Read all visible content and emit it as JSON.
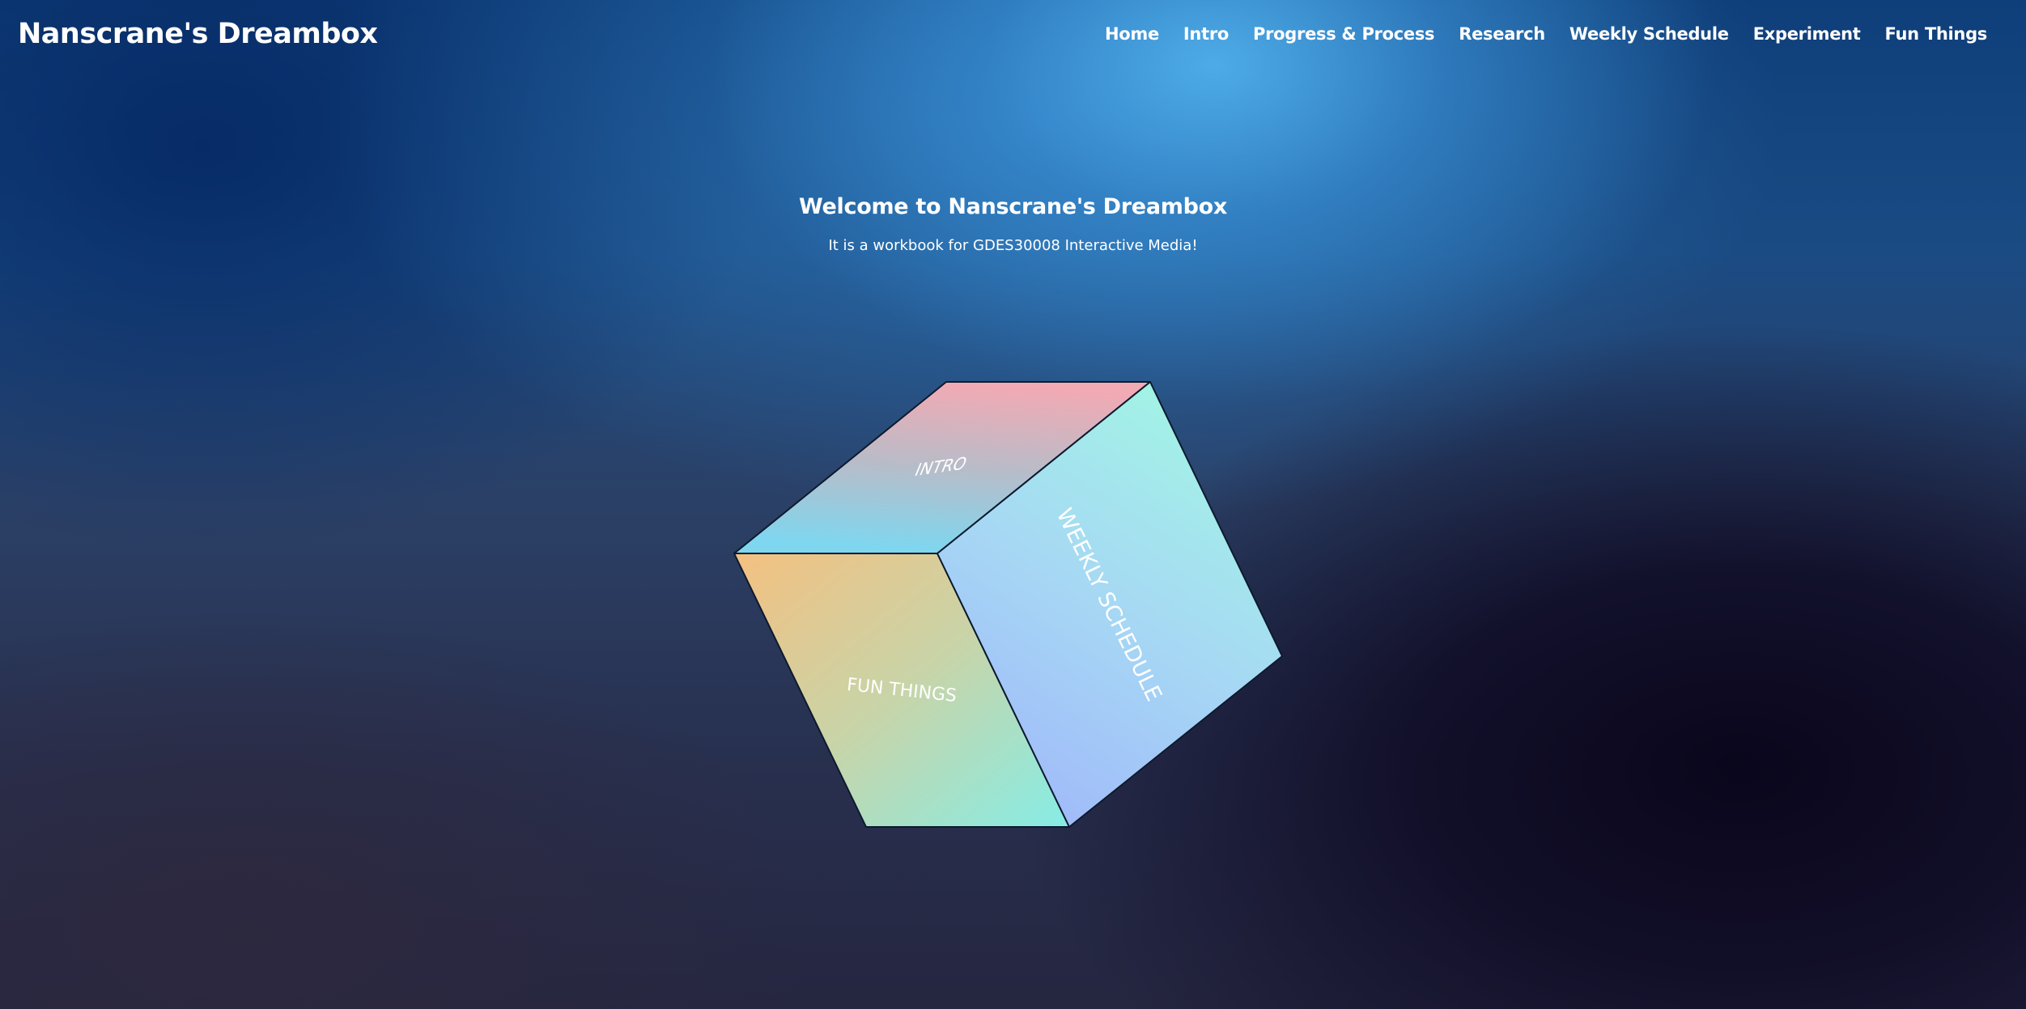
{
  "header": {
    "site_title": "Nanscrane's Dreambox",
    "nav": [
      {
        "label": "Home"
      },
      {
        "label": "Intro"
      },
      {
        "label": "Progress & Process"
      },
      {
        "label": "Research"
      },
      {
        "label": "Weekly Schedule"
      },
      {
        "label": "Experiment"
      },
      {
        "label": "Fun Things"
      }
    ]
  },
  "hero": {
    "title": "Welcome to Nanscrane's Dreambox",
    "subtitle": "It is a workbook for GDES30008 Interactive Media!"
  },
  "cube": {
    "faces": {
      "top": {
        "label": "INTRO"
      },
      "front": {
        "label": "FUN THINGS"
      },
      "right": {
        "label": "WEEKLY SCHEDULE"
      }
    }
  },
  "colors": {
    "text": "#ffffff",
    "cube_edge": "#0d1a2e",
    "top_gradient": [
      "#f2aab4",
      "#b8bcc8",
      "#7fd6ef"
    ],
    "front_gradient": [
      "#f4c080",
      "#c8d4a8",
      "#86ede6"
    ],
    "right_gradient": [
      "#a2f6e4",
      "#a6d8f4",
      "#a0b8fa"
    ]
  }
}
